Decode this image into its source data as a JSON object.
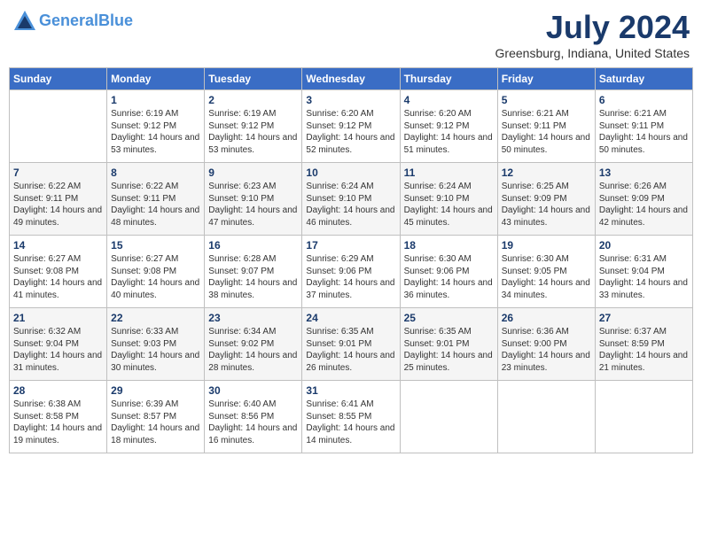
{
  "header": {
    "logo_line1": "General",
    "logo_line2": "Blue",
    "month_title": "July 2024",
    "location": "Greensburg, Indiana, United States"
  },
  "weekdays": [
    "Sunday",
    "Monday",
    "Tuesday",
    "Wednesday",
    "Thursday",
    "Friday",
    "Saturday"
  ],
  "weeks": [
    [
      {
        "day": "",
        "sunrise": "",
        "sunset": "",
        "daylight": ""
      },
      {
        "day": "1",
        "sunrise": "Sunrise: 6:19 AM",
        "sunset": "Sunset: 9:12 PM",
        "daylight": "Daylight: 14 hours and 53 minutes."
      },
      {
        "day": "2",
        "sunrise": "Sunrise: 6:19 AM",
        "sunset": "Sunset: 9:12 PM",
        "daylight": "Daylight: 14 hours and 53 minutes."
      },
      {
        "day": "3",
        "sunrise": "Sunrise: 6:20 AM",
        "sunset": "Sunset: 9:12 PM",
        "daylight": "Daylight: 14 hours and 52 minutes."
      },
      {
        "day": "4",
        "sunrise": "Sunrise: 6:20 AM",
        "sunset": "Sunset: 9:12 PM",
        "daylight": "Daylight: 14 hours and 51 minutes."
      },
      {
        "day": "5",
        "sunrise": "Sunrise: 6:21 AM",
        "sunset": "Sunset: 9:11 PM",
        "daylight": "Daylight: 14 hours and 50 minutes."
      },
      {
        "day": "6",
        "sunrise": "Sunrise: 6:21 AM",
        "sunset": "Sunset: 9:11 PM",
        "daylight": "Daylight: 14 hours and 50 minutes."
      }
    ],
    [
      {
        "day": "7",
        "sunrise": "Sunrise: 6:22 AM",
        "sunset": "Sunset: 9:11 PM",
        "daylight": "Daylight: 14 hours and 49 minutes."
      },
      {
        "day": "8",
        "sunrise": "Sunrise: 6:22 AM",
        "sunset": "Sunset: 9:11 PM",
        "daylight": "Daylight: 14 hours and 48 minutes."
      },
      {
        "day": "9",
        "sunrise": "Sunrise: 6:23 AM",
        "sunset": "Sunset: 9:10 PM",
        "daylight": "Daylight: 14 hours and 47 minutes."
      },
      {
        "day": "10",
        "sunrise": "Sunrise: 6:24 AM",
        "sunset": "Sunset: 9:10 PM",
        "daylight": "Daylight: 14 hours and 46 minutes."
      },
      {
        "day": "11",
        "sunrise": "Sunrise: 6:24 AM",
        "sunset": "Sunset: 9:10 PM",
        "daylight": "Daylight: 14 hours and 45 minutes."
      },
      {
        "day": "12",
        "sunrise": "Sunrise: 6:25 AM",
        "sunset": "Sunset: 9:09 PM",
        "daylight": "Daylight: 14 hours and 43 minutes."
      },
      {
        "day": "13",
        "sunrise": "Sunrise: 6:26 AM",
        "sunset": "Sunset: 9:09 PM",
        "daylight": "Daylight: 14 hours and 42 minutes."
      }
    ],
    [
      {
        "day": "14",
        "sunrise": "Sunrise: 6:27 AM",
        "sunset": "Sunset: 9:08 PM",
        "daylight": "Daylight: 14 hours and 41 minutes."
      },
      {
        "day": "15",
        "sunrise": "Sunrise: 6:27 AM",
        "sunset": "Sunset: 9:08 PM",
        "daylight": "Daylight: 14 hours and 40 minutes."
      },
      {
        "day": "16",
        "sunrise": "Sunrise: 6:28 AM",
        "sunset": "Sunset: 9:07 PM",
        "daylight": "Daylight: 14 hours and 38 minutes."
      },
      {
        "day": "17",
        "sunrise": "Sunrise: 6:29 AM",
        "sunset": "Sunset: 9:06 PM",
        "daylight": "Daylight: 14 hours and 37 minutes."
      },
      {
        "day": "18",
        "sunrise": "Sunrise: 6:30 AM",
        "sunset": "Sunset: 9:06 PM",
        "daylight": "Daylight: 14 hours and 36 minutes."
      },
      {
        "day": "19",
        "sunrise": "Sunrise: 6:30 AM",
        "sunset": "Sunset: 9:05 PM",
        "daylight": "Daylight: 14 hours and 34 minutes."
      },
      {
        "day": "20",
        "sunrise": "Sunrise: 6:31 AM",
        "sunset": "Sunset: 9:04 PM",
        "daylight": "Daylight: 14 hours and 33 minutes."
      }
    ],
    [
      {
        "day": "21",
        "sunrise": "Sunrise: 6:32 AM",
        "sunset": "Sunset: 9:04 PM",
        "daylight": "Daylight: 14 hours and 31 minutes."
      },
      {
        "day": "22",
        "sunrise": "Sunrise: 6:33 AM",
        "sunset": "Sunset: 9:03 PM",
        "daylight": "Daylight: 14 hours and 30 minutes."
      },
      {
        "day": "23",
        "sunrise": "Sunrise: 6:34 AM",
        "sunset": "Sunset: 9:02 PM",
        "daylight": "Daylight: 14 hours and 28 minutes."
      },
      {
        "day": "24",
        "sunrise": "Sunrise: 6:35 AM",
        "sunset": "Sunset: 9:01 PM",
        "daylight": "Daylight: 14 hours and 26 minutes."
      },
      {
        "day": "25",
        "sunrise": "Sunrise: 6:35 AM",
        "sunset": "Sunset: 9:01 PM",
        "daylight": "Daylight: 14 hours and 25 minutes."
      },
      {
        "day": "26",
        "sunrise": "Sunrise: 6:36 AM",
        "sunset": "Sunset: 9:00 PM",
        "daylight": "Daylight: 14 hours and 23 minutes."
      },
      {
        "day": "27",
        "sunrise": "Sunrise: 6:37 AM",
        "sunset": "Sunset: 8:59 PM",
        "daylight": "Daylight: 14 hours and 21 minutes."
      }
    ],
    [
      {
        "day": "28",
        "sunrise": "Sunrise: 6:38 AM",
        "sunset": "Sunset: 8:58 PM",
        "daylight": "Daylight: 14 hours and 19 minutes."
      },
      {
        "day": "29",
        "sunrise": "Sunrise: 6:39 AM",
        "sunset": "Sunset: 8:57 PM",
        "daylight": "Daylight: 14 hours and 18 minutes."
      },
      {
        "day": "30",
        "sunrise": "Sunrise: 6:40 AM",
        "sunset": "Sunset: 8:56 PM",
        "daylight": "Daylight: 14 hours and 16 minutes."
      },
      {
        "day": "31",
        "sunrise": "Sunrise: 6:41 AM",
        "sunset": "Sunset: 8:55 PM",
        "daylight": "Daylight: 14 hours and 14 minutes."
      },
      {
        "day": "",
        "sunrise": "",
        "sunset": "",
        "daylight": ""
      },
      {
        "day": "",
        "sunrise": "",
        "sunset": "",
        "daylight": ""
      },
      {
        "day": "",
        "sunrise": "",
        "sunset": "",
        "daylight": ""
      }
    ]
  ]
}
